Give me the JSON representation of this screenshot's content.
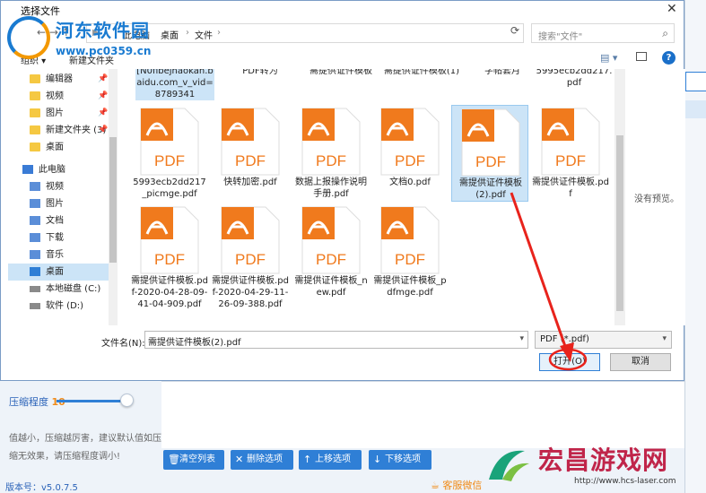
{
  "dialog": {
    "title": "选择文件",
    "breadcrumbs": [
      "此电脑",
      "桌面",
      "文件"
    ],
    "search_placeholder": "搜索\"文件\"",
    "organize": "组织 ▾",
    "new_folder": "新建文件夹",
    "no_preview": "没有预览。",
    "filename_label": "文件名(N):",
    "filename_value": "需提供证件模板(2).pdf",
    "filetype_value": "PDF (*.pdf)",
    "open_label": "打开(O)",
    "cancel_label": "取消"
  },
  "nav": {
    "items": [
      {
        "label": "编辑器"
      },
      {
        "label": "视频"
      },
      {
        "label": "图片"
      },
      {
        "label": "新建文件夹 (3)"
      },
      {
        "label": "桌面"
      },
      {
        "label": "此电脑"
      },
      {
        "label": "视频"
      },
      {
        "label": "图片"
      },
      {
        "label": "文档"
      },
      {
        "label": "下载"
      },
      {
        "label": "音乐"
      },
      {
        "label": "桌面"
      },
      {
        "label": "本地磁盘 (C:)"
      },
      {
        "label": "软件 (D:)"
      }
    ]
  },
  "files": {
    "top_row": [
      "[N0fibejhaokan.baidu.com_v_vid=8789341",
      "PDF转为",
      "需提供证件模板",
      "需提供证件模板(1)",
      "字帖套月",
      "5995ecb2dd217.pdf"
    ],
    "items": [
      {
        "name": "5993ecb2dd217_picmge.pdf"
      },
      {
        "name": "快转加密.pdf"
      },
      {
        "name": "数据上报操作说明手册.pdf"
      },
      {
        "name": "文档0.pdf"
      },
      {
        "name": "需提供证件模板(2).pdf"
      },
      {
        "name": "需提供证件模板.pdf"
      },
      {
        "name": "需提供证件模板.pdf-2020-04-28-09-41-04-909.pdf"
      },
      {
        "name": "需提供证件模板.pdf-2020-04-29-11-26-09-388.pdf"
      },
      {
        "name": "需提供证件模板_new.pdf"
      },
      {
        "name": "需提供证件模板_pdfmge.pdf"
      }
    ],
    "icon_text": "PDF",
    "icon_color": "#f07a1d"
  },
  "app": {
    "compress_label": "压缩程度",
    "compress_value": "10",
    "tip": "值越小，压缩越厉害，建议默认值如压缩无效果，请压缩程度调小!",
    "version": "版本号：v5.0.7.5",
    "service": "客服微信",
    "toolbar": [
      "清空列表",
      "删除选项",
      "上移选项",
      "下移选项"
    ]
  },
  "watermarks": {
    "site1_name": "河东软件园",
    "site1_url": "www.pc0359.cn",
    "site2_name": "宏昌游戏网",
    "site2_url": "http://www.hcs-laser.com"
  }
}
